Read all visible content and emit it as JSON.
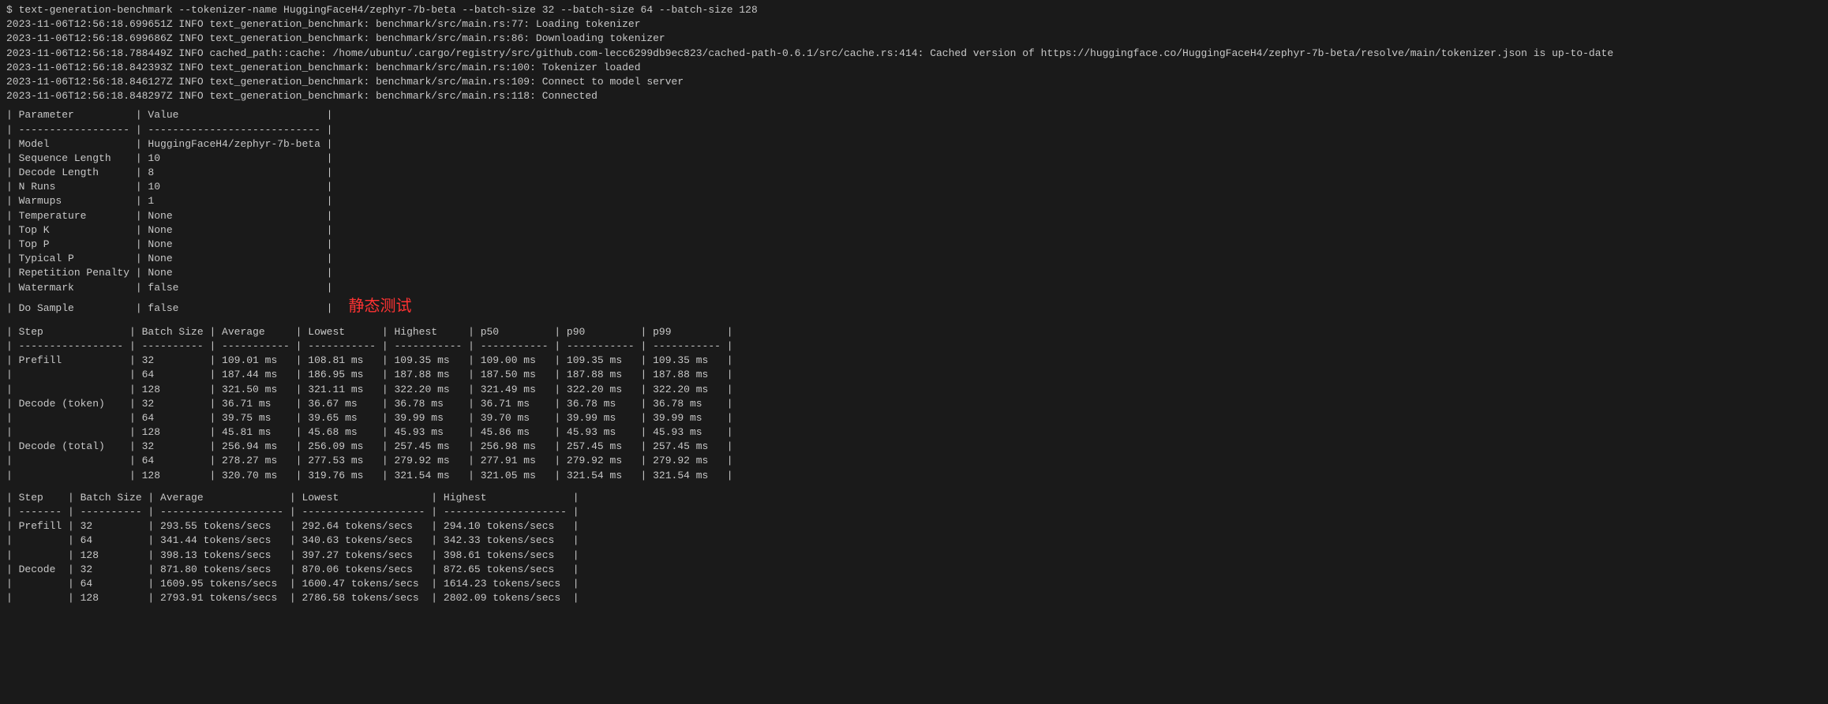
{
  "terminal": {
    "command": "$ text-generation-benchmark --tokenizer-name HuggingFaceH4/zephyr-7b-beta --batch-size 32 --batch-size 64 --batch-size 128",
    "log_lines": [
      "2023-11-06T12:56:18.699651Z  INFO text_generation_benchmark: benchmark/src/main.rs:77: Loading tokenizer",
      "2023-11-06T12:56:18.699686Z  INFO text_generation_benchmark: benchmark/src/main.rs:86: Downloading tokenizer",
      "2023-11-06T12:56:18.788449Z  INFO cached_path::cache: /home/ubuntu/.cargo/registry/src/github.com-lecc6299db9ec823/cached-path-0.6.1/src/cache.rs:414: Cached version of https://huggingface.co/HuggingFaceH4/zephyr-7b-beta/resolve/main/tokenizer.json is up-to-date",
      "2023-11-06T12:56:18.842393Z  INFO text_generation_benchmark: benchmark/src/main.rs:100: Tokenizer loaded",
      "2023-11-06T12:56:18.846127Z  INFO text_generation_benchmark: benchmark/src/main.rs:109: Connect to model server",
      "2023-11-06T12:56:18.848297Z  INFO text_generation_benchmark: benchmark/src/main.rs:118: Connected"
    ],
    "params": {
      "header": [
        "Parameter",
        "Value"
      ],
      "rows": [
        [
          "Model",
          "HuggingFaceH4/zephyr-7b-beta"
        ],
        [
          "Sequence Length",
          "10"
        ],
        [
          "Decode Length",
          "8"
        ],
        [
          "N Runs",
          "10"
        ],
        [
          "Warmups",
          "1"
        ],
        [
          "Temperature",
          "None"
        ],
        [
          "Top K",
          "None"
        ],
        [
          "Top P",
          "None"
        ],
        [
          "Typical P",
          "None"
        ],
        [
          "Repetition Penalty",
          "None"
        ],
        [
          "Watermark",
          "false"
        ],
        [
          "Do Sample",
          "false"
        ]
      ]
    },
    "chinese_label": "静态测试",
    "timing_table": {
      "headers": [
        "Step",
        "Batch Size",
        "Average",
        "Lowest",
        "Highest",
        "p50",
        "p90",
        "p99"
      ],
      "rows": [
        [
          "Prefill",
          "32",
          "109.01 ms",
          "108.81 ms",
          "109.35 ms",
          "109.00 ms",
          "109.35 ms",
          "109.35 ms"
        ],
        [
          "",
          "64",
          "187.44 ms",
          "186.95 ms",
          "187.88 ms",
          "187.50 ms",
          "187.88 ms",
          "187.88 ms"
        ],
        [
          "",
          "128",
          "321.50 ms",
          "321.11 ms",
          "322.20 ms",
          "321.49 ms",
          "322.20 ms",
          "322.20 ms"
        ],
        [
          "Decode (token)",
          "32",
          "36.71 ms",
          "36.67 ms",
          "36.78 ms",
          "36.71 ms",
          "36.78 ms",
          "36.78 ms"
        ],
        [
          "",
          "64",
          "39.75 ms",
          "39.65 ms",
          "39.99 ms",
          "39.70 ms",
          "39.99 ms",
          "39.99 ms"
        ],
        [
          "",
          "128",
          "45.81 ms",
          "45.68 ms",
          "45.93 ms",
          "45.86 ms",
          "45.93 ms",
          "45.93 ms"
        ],
        [
          "Decode (total)",
          "32",
          "256.94 ms",
          "256.09 ms",
          "257.45 ms",
          "256.98 ms",
          "257.45 ms",
          "257.45 ms"
        ],
        [
          "",
          "64",
          "278.27 ms",
          "277.53 ms",
          "279.92 ms",
          "277.91 ms",
          "279.92 ms",
          "279.92 ms"
        ],
        [
          "",
          "128",
          "320.70 ms",
          "319.76 ms",
          "321.54 ms",
          "321.05 ms",
          "321.54 ms",
          "321.54 ms"
        ]
      ]
    },
    "throughput_table": {
      "headers": [
        "Step",
        "Batch Size",
        "Average",
        "Lowest",
        "Highest"
      ],
      "rows": [
        [
          "Prefill",
          "32",
          "293.55 tokens/secs",
          "292.64 tokens/secs",
          "294.10 tokens/secs"
        ],
        [
          "",
          "64",
          "341.44 tokens/secs",
          "340.63 tokens/secs",
          "342.33 tokens/secs"
        ],
        [
          "",
          "128",
          "398.13 tokens/secs",
          "397.27 tokens/secs",
          "398.61 tokens/secs"
        ],
        [
          "Decode",
          "32",
          "871.80 tokens/secs",
          "870.06 tokens/secs",
          "872.65 tokens/secs"
        ],
        [
          "",
          "64",
          "1609.95 tokens/secs",
          "1600.47 tokens/secs",
          "1614.23 tokens/secs"
        ],
        [
          "",
          "128",
          "2793.91 tokens/secs",
          "2786.58 tokens/secs",
          "2802.09 tokens/secs"
        ]
      ]
    }
  }
}
